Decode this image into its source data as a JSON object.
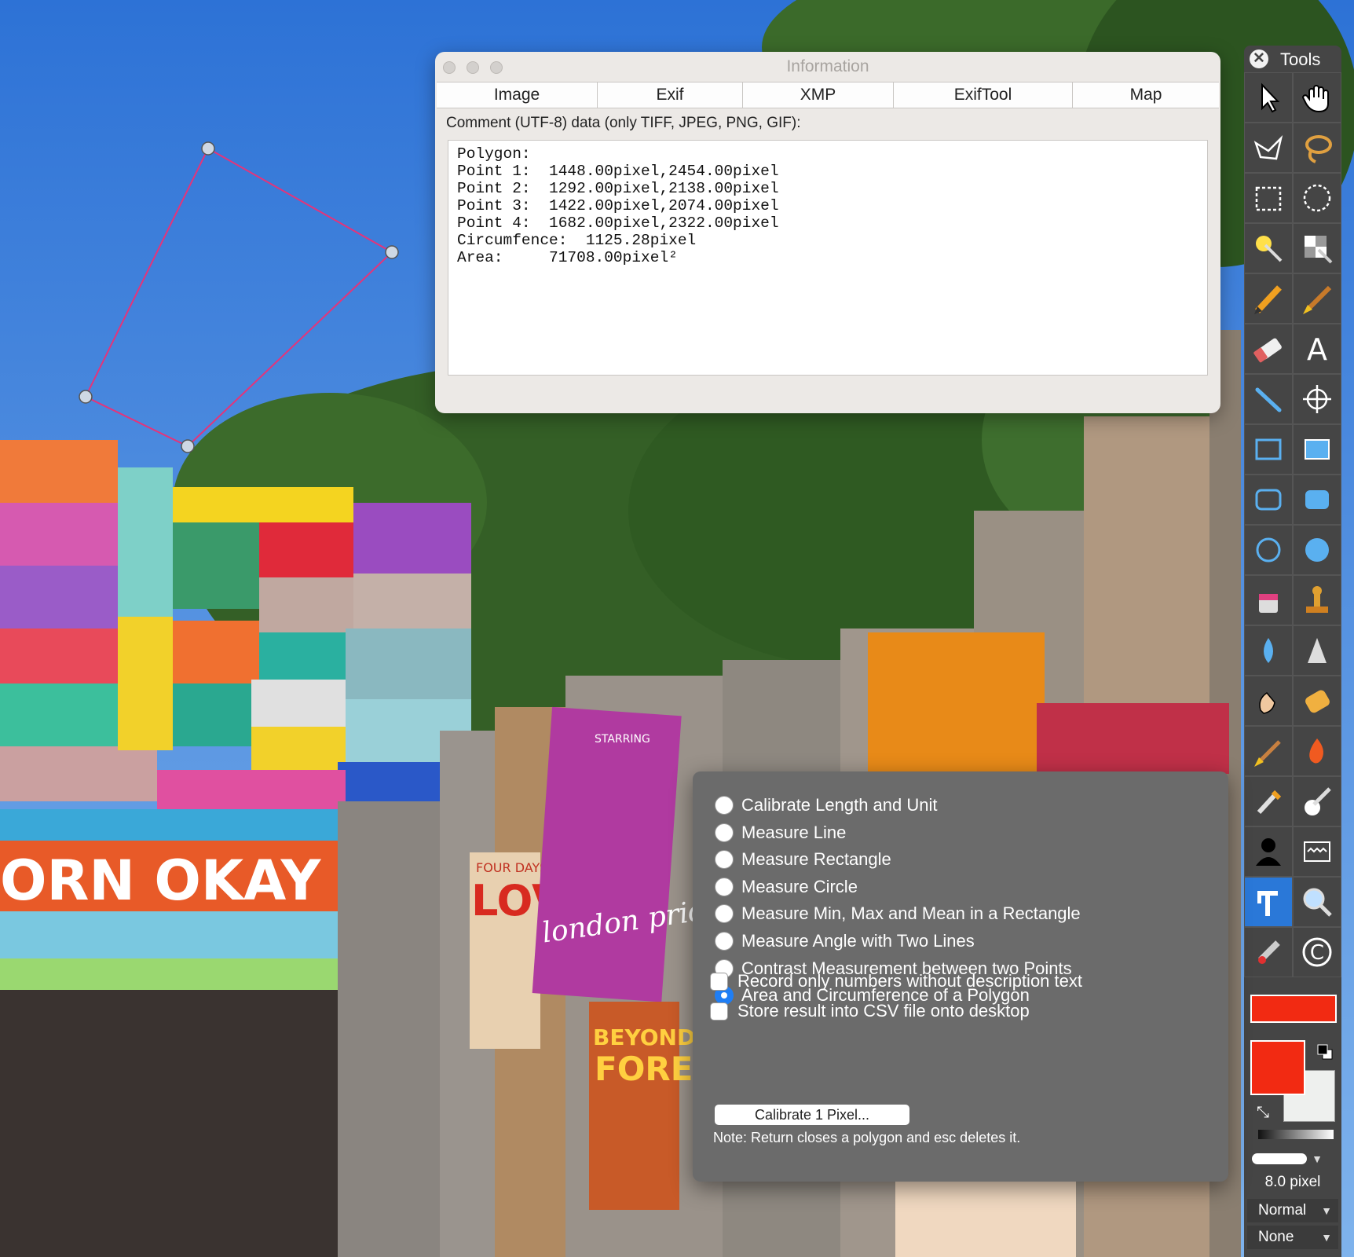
{
  "info_window": {
    "title": "Information",
    "tabs": [
      "Image",
      "Exif",
      "XMP",
      "ExifTool",
      "Map"
    ],
    "comment_label": "Comment (UTF-8) data (only TIFF, JPEG, PNG, GIF):",
    "comment_lines": [
      "Polygon:",
      "Point 1:  1448.00pixel,2454.00pixel",
      "Point 2:  1292.00pixel,2138.00pixel",
      "Point 3:  1422.00pixel,2074.00pixel",
      "Point 4:  1682.00pixel,2322.00pixel",
      "Circumfence:  1125.28pixel",
      "Area:     71708.00pixel²"
    ]
  },
  "photo": {
    "poster_texts": [
      "ORN OKAY P",
      "FOUR DAYS OF",
      "LOVE",
      "STARRING",
      "london pride",
      "BEYOND THE",
      "FOREST"
    ]
  },
  "tools_palette": {
    "title": "Tools",
    "tools": [
      "arrow-select-icon",
      "hand-icon",
      "polygon-lasso-icon",
      "lasso-icon",
      "rect-select-icon",
      "ellipse-select-icon",
      "magic-wand-icon",
      "checker-select-icon",
      "pencil-icon",
      "brush-icon",
      "eraser-icon",
      "text-icon",
      "line-icon",
      "crosshair-icon",
      "rectangle-icon",
      "filled-rectangle-icon",
      "rounded-rect-icon",
      "filled-rounded-rect-icon",
      "ellipse-icon",
      "filled-ellipse-icon",
      "paint-bucket-icon",
      "stamp-icon",
      "blur-drop-icon",
      "sharpen-cone-icon",
      "smudge-finger-icon",
      "sponge-icon",
      "dodge-brush-icon",
      "burn-flame-icon",
      "eyedropper-icon",
      "color-replace-icon",
      "silhouette-icon",
      "pattern-icon",
      "measure-calipers-icon",
      "zoom-icon",
      "red-eye-icon",
      "copyright-icon"
    ],
    "active_tool": "measure-calipers-icon",
    "colors": {
      "foreground": "#f22a12",
      "background": "#eef0ee",
      "bar": "#f22a12"
    },
    "brush_size": "8.0 pixel",
    "blend_mode": "Normal",
    "effect": "None"
  },
  "measure_popover": {
    "options": [
      {
        "label": "Calibrate Length and Unit",
        "selected": false
      },
      {
        "label": "Measure Line",
        "selected": false
      },
      {
        "label": "Measure Rectangle",
        "selected": false
      },
      {
        "label": "Measure Circle",
        "selected": false
      },
      {
        "label": "Measure Min, Max and Mean in a Rectangle",
        "selected": false
      },
      {
        "label": "Measure Angle with Two Lines",
        "selected": false
      },
      {
        "label": "Contrast Measurement between two Points",
        "selected": false
      },
      {
        "label": "Area and Circumference of a Polygon",
        "selected": true
      }
    ],
    "checkboxes": [
      {
        "label": "Record only numbers without description text",
        "checked": false
      },
      {
        "label": "Store result into CSV file onto desktop",
        "checked": false
      }
    ],
    "calibrate_button": "Calibrate 1 Pixel...",
    "note": "Note: Return closes a polygon and esc deletes it."
  },
  "polygon_color": "#e4347a"
}
